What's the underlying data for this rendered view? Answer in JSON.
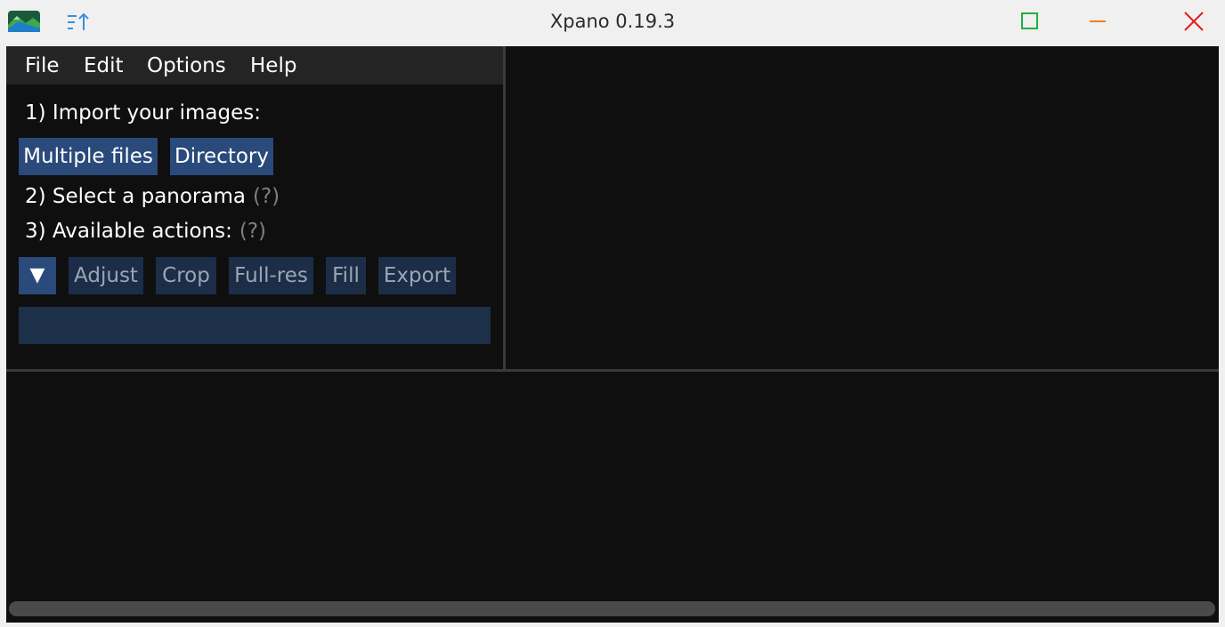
{
  "window": {
    "title": "Xpano 0.19.3"
  },
  "icons": {
    "app_logo": "mountain-logo-icon",
    "sort": "sort-ascending-icon",
    "maximize": "maximize-icon",
    "minimize": "minimize-icon",
    "close": "close-icon",
    "dropdown": "triangle-down-icon"
  },
  "colors": {
    "maximize": "#22b03c",
    "minimize": "#f0801f",
    "close": "#e02020",
    "accent_button": "#294a7a",
    "disabled_button": "#1c2d47"
  },
  "menu": {
    "items": [
      {
        "label": "File"
      },
      {
        "label": "Edit"
      },
      {
        "label": "Options"
      },
      {
        "label": "Help"
      }
    ]
  },
  "steps": {
    "import_label": "1) Import your images:",
    "import_buttons": {
      "multiple_files": "Multiple files",
      "directory": "Directory"
    },
    "select_label": "2) Select a panorama",
    "select_help": "(?)",
    "actions_label": "3) Available actions:",
    "actions_help": "(?)",
    "action_buttons": {
      "dropdown": "▼",
      "adjust": "Adjust",
      "crop": "Crop",
      "full_res": "Full-res",
      "fill": "Fill",
      "export": "Export"
    }
  }
}
